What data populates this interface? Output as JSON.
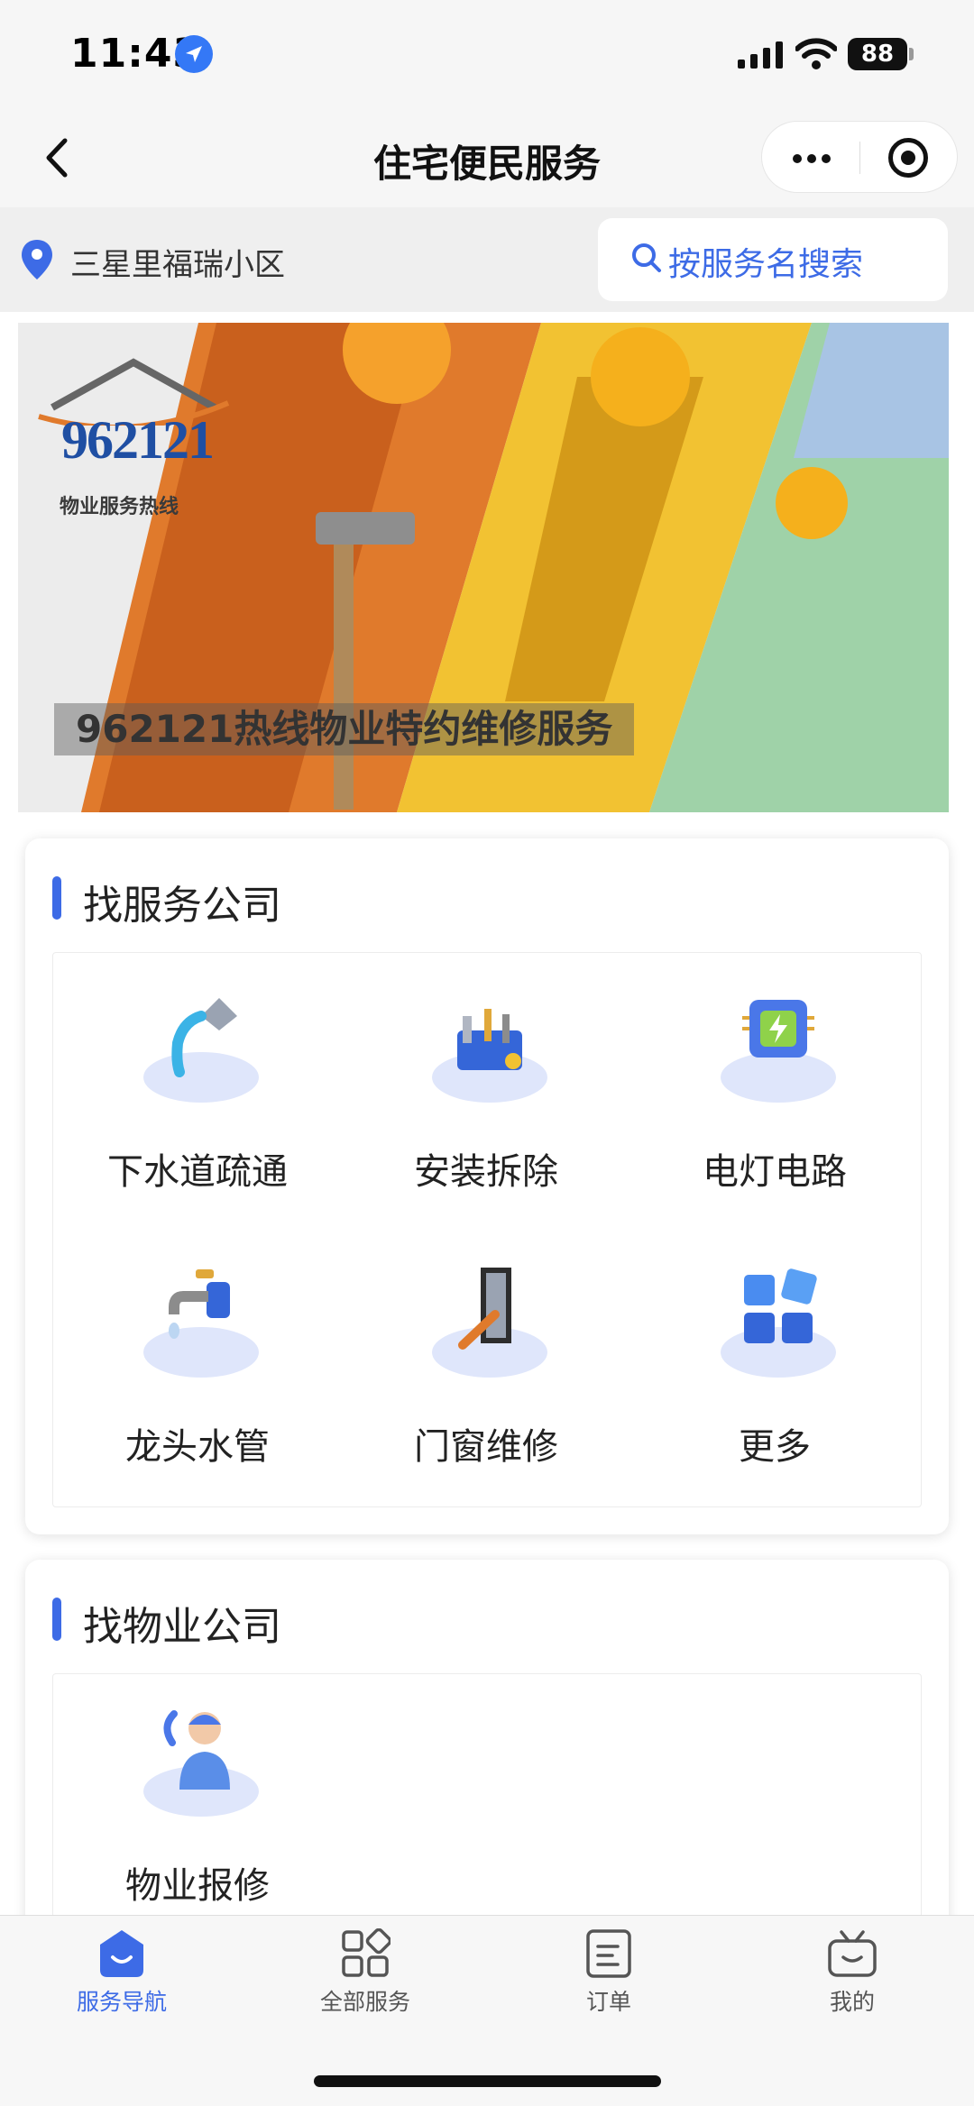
{
  "status_bar": {
    "time": "11:43",
    "battery": "88"
  },
  "nav": {
    "title": "住宅便民服务"
  },
  "location": {
    "community": "三星里福瑞小区"
  },
  "search": {
    "placeholder": "按服务名搜索"
  },
  "banner": {
    "logo_number": "962121",
    "logo_subtitle": "物业服务热线",
    "caption": "962121热线物业特约维修服务"
  },
  "services_section": {
    "title": "找服务公司",
    "items": [
      {
        "label": "下水道疏通",
        "icon": "drain-pipe-icon"
      },
      {
        "label": "安装拆除",
        "icon": "toolbox-icon"
      },
      {
        "label": "电灯电路",
        "icon": "circuit-chip-icon"
      },
      {
        "label": "龙头水管",
        "icon": "faucet-icon"
      },
      {
        "label": "门窗维修",
        "icon": "door-window-icon"
      },
      {
        "label": "更多",
        "icon": "more-grid-icon"
      }
    ]
  },
  "property_section": {
    "title": "找物业公司",
    "items": [
      {
        "label": "物业报修",
        "icon": "customer-service-icon"
      }
    ]
  },
  "tab_bar": {
    "active_color": "#3d6be6",
    "tabs": [
      {
        "label": "服务导航",
        "icon": "home-icon",
        "active": true
      },
      {
        "label": "全部服务",
        "icon": "apps-icon",
        "active": false
      },
      {
        "label": "订单",
        "icon": "order-icon",
        "active": false
      },
      {
        "label": "我的",
        "icon": "profile-tv-icon",
        "active": false
      }
    ]
  }
}
